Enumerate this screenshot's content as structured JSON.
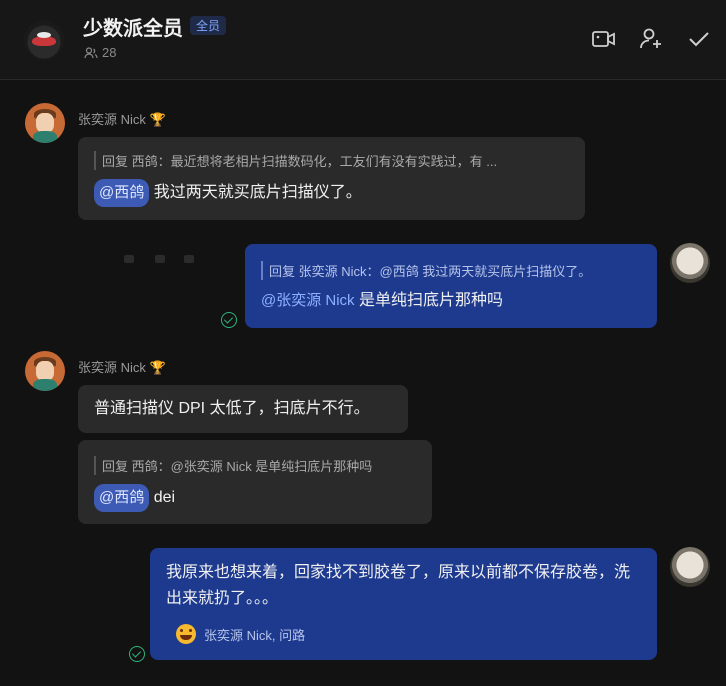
{
  "header": {
    "title": "少数派全员",
    "badge": "全员",
    "member_count": "28"
  },
  "messages": [
    {
      "sender": "张奕源 Nick",
      "reply": "回复 西鸽：最近想将老相片扫描数码化，工友们有没有实践过，有 ...",
      "mention": "@西鸽",
      "text": "我过两天就买底片扫描仪了。"
    },
    {
      "reply": "回复 张奕源 Nick：@西鸽 我过两天就买底片扫描仪了。",
      "mention": "@张奕源 Nick",
      "text": "是单纯扫底片那种吗"
    },
    {
      "sender": "张奕源 Nick",
      "text": "普通扫描仪 DPI 太低了，扫底片不行。"
    },
    {
      "reply": "回复 西鸽：@张奕源 Nick 是单纯扫底片那种吗",
      "mention": "@西鸽",
      "text": "dei"
    },
    {
      "text": "我原来也想来着，回家找不到胶卷了，原来以前都不保存胶卷，洗出来就扔了。。。",
      "reaction": "张奕源 Nick, 问路"
    }
  ]
}
